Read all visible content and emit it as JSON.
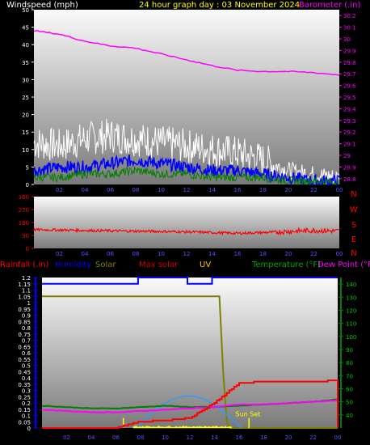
{
  "header": {
    "wind_label": "Windspeed (mph)",
    "title": "24 hour graph day : 03 November 2024",
    "baro_label": "Barometer (.in)"
  },
  "colors": {
    "background": "#000000",
    "wind_gust": "#ffffff",
    "wind_avg_blue": "#0000ff",
    "wind_avg_green": "#008000",
    "barometer": "#ff00ff",
    "wind_dir": "#ff0000",
    "rain": "#ff0000",
    "humidity": "#0000ff",
    "solar": "#808000",
    "max_solar": "#3399ff",
    "uv": "#ffff00",
    "temperature": "#008000",
    "dewpoint": "#ff00ff",
    "header_title": "#ffff00",
    "left_axis_green": "#00cc00",
    "right_axis_magenta": "#ff00ff"
  },
  "x_ticks": [
    "02",
    "04",
    "06",
    "08",
    "10",
    "12",
    "14",
    "16",
    "18",
    "20",
    "22",
    "00"
  ],
  "wind_axis": {
    "ticks": [
      "0",
      "5",
      "10",
      "15",
      "20",
      "25",
      "30",
      "35",
      "40",
      "45",
      "50"
    ],
    "ylim": [
      0,
      50
    ]
  },
  "baro_axis": {
    "ticks": [
      "28.8",
      "28.9",
      "29",
      "29.1",
      "29.2",
      "29.3",
      "29.4",
      "29.5",
      "29.6",
      "29.7",
      "29.8",
      "29.9",
      "30",
      "30.1",
      "30.2"
    ],
    "ylim": [
      28.75,
      30.25
    ]
  },
  "dir_axis": {
    "ticks": [
      "0",
      "90",
      "180",
      "270",
      "360"
    ],
    "letters": [
      "N",
      "W",
      "S",
      "E",
      "N"
    ],
    "ylim": [
      0,
      360
    ]
  },
  "bottom_labels": {
    "rainfall": "Rainfall (.in)",
    "humidity": "Humidity",
    "solar": "Solar",
    "max_solar": "Max solar",
    "uv": "UV",
    "temperature": "Temperature (°F)",
    "dewpoint": "Dew Point (°F)"
  },
  "rain_axis": {
    "ticks": [
      "0",
      "0.05",
      "0.1",
      "0.15",
      "0.2",
      "0.25",
      "0.3",
      "0.35",
      "0.4",
      "0.45",
      "0.5",
      "0.55",
      "0.6",
      "0.65",
      "0.7",
      "0.75",
      "0.8",
      "0.85",
      "0.9",
      "0.95",
      "1",
      "1.05",
      "1.1",
      "1.15",
      "1.2"
    ],
    "ylim": [
      0,
      1.2
    ]
  },
  "temp_axis": {
    "ticks": [
      "40",
      "50",
      "60",
      "70",
      "80",
      "90",
      "100",
      "110",
      "120",
      "130",
      "140"
    ],
    "ylim": [
      30,
      145
    ]
  },
  "annotation": "Sun Set",
  "chart_data": [
    {
      "type": "line",
      "title": "24 hour graph day : 03 November 2024",
      "ylabel": "Windspeed (mph)",
      "y2label": "Barometer (.in)",
      "x": [
        0,
        2,
        4,
        6,
        8,
        10,
        12,
        14,
        16,
        18,
        20,
        22,
        24
      ],
      "xlim": [
        0,
        24
      ],
      "ylim": [
        0,
        50
      ],
      "y2lim": [
        28.75,
        30.25
      ],
      "series": [
        {
          "name": "Windspeed (mph)",
          "values": [
            12,
            11,
            13,
            14,
            13,
            12,
            11,
            10,
            9,
            7,
            4,
            3,
            2
          ]
        },
        {
          "values": [
            4,
            5,
            5,
            6,
            7,
            6,
            5,
            4,
            4,
            3,
            2,
            1,
            1
          ]
        },
        {
          "values": [
            2,
            2,
            3,
            3,
            4,
            3,
            3,
            2,
            2,
            2,
            1,
            1,
            0.5
          ]
        },
        {
          "name": "Barometer (.in)",
          "axis": "right",
          "values": [
            30.07,
            30.04,
            29.98,
            29.94,
            29.92,
            29.87,
            29.82,
            29.77,
            29.73,
            29.72,
            29.72,
            29.71,
            29.69
          ]
        }
      ]
    },
    {
      "type": "line",
      "x": [
        0,
        2,
        4,
        6,
        8,
        10,
        12,
        14,
        16,
        18,
        20,
        22,
        24
      ],
      "xlim": [
        0,
        24
      ],
      "ylim": [
        0,
        360
      ],
      "series": [
        {
          "values": [
            130,
            128,
            125,
            122,
            120,
            118,
            115,
            110,
            105,
            110,
            118,
            125,
            120
          ]
        }
      ]
    },
    {
      "type": "line",
      "x": [
        0,
        2,
        4,
        6,
        8,
        10,
        12,
        14,
        16,
        18,
        20,
        22,
        24
      ],
      "xlim": [
        0,
        24
      ],
      "ylabel": "Rainfall (.in)",
      "y2label": "Temperature (°F)",
      "ylim": [
        0,
        1.2
      ],
      "y2lim": [
        30,
        145
      ],
      "series": [
        {
          "name": "Rainfall (.in)",
          "values": [
            0,
            0,
            0,
            0,
            0.05,
            0.06,
            0.08,
            0.2,
            0.36,
            0.37,
            0.37,
            0.37,
            0.38
          ]
        },
        {
          "name": "Humidity",
          "values": [
            1.15,
            1.15,
            1.15,
            1.15,
            1.2,
            1.2,
            1.15,
            1.2,
            1.2,
            1.2,
            1.2,
            1.2,
            1.2
          ]
        },
        {
          "name": "Solar",
          "values": [
            1.05,
            1.05,
            1.05,
            1.05,
            1.05,
            1.05,
            1.05,
            1.05,
            0,
            0,
            0,
            0,
            0
          ]
        },
        {
          "name": "Max solar",
          "values": [
            0,
            0,
            0,
            0,
            0,
            0.14,
            0.25,
            0.2,
            0,
            0,
            0,
            0,
            0
          ]
        },
        {
          "name": "UV",
          "values": [
            0,
            0,
            0,
            0,
            0,
            0.01,
            0.02,
            0.01,
            0,
            0,
            0,
            0,
            0
          ]
        },
        {
          "name": "Temperature (°F)",
          "axis": "right",
          "values": [
            47,
            46,
            45,
            45,
            46,
            47,
            46,
            46,
            47,
            48,
            49,
            50,
            52
          ]
        },
        {
          "name": "Dew Point (°F)",
          "axis": "right",
          "values": [
            44,
            43,
            42,
            42,
            43,
            44,
            45,
            46,
            48,
            48,
            49,
            50,
            51
          ]
        }
      ]
    }
  ]
}
